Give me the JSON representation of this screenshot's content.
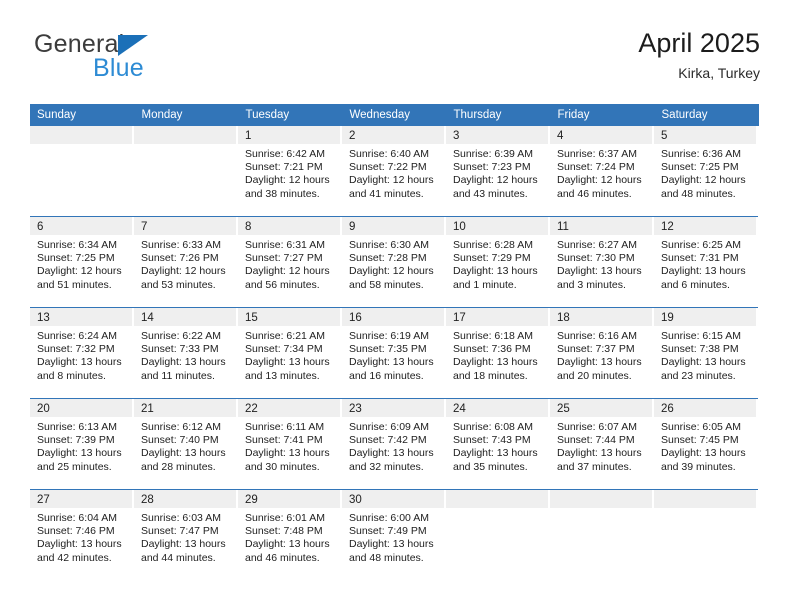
{
  "brand": {
    "name_top": "General",
    "name_bottom": "Blue",
    "accent_blue": "#2d8bd4",
    "triangle_blue": "#1b70b8",
    "header_blue": "#3275b8"
  },
  "header": {
    "title": "April 2025",
    "subtitle": "Kirka, Turkey"
  },
  "weekdays": [
    "Sunday",
    "Monday",
    "Tuesday",
    "Wednesday",
    "Thursday",
    "Friday",
    "Saturday"
  ],
  "labels": {
    "sunrise_prefix": "Sunrise:",
    "sunset_prefix": "Sunset:",
    "daylight_prefix": "Daylight:"
  },
  "weeks": [
    [
      {
        "empty": true
      },
      {
        "empty": true
      },
      {
        "day": "1",
        "sunrise": "Sunrise: 6:42 AM",
        "sunset": "Sunset: 7:21 PM",
        "daylight_1": "Daylight: 12 hours",
        "daylight_2": "and 38 minutes."
      },
      {
        "day": "2",
        "sunrise": "Sunrise: 6:40 AM",
        "sunset": "Sunset: 7:22 PM",
        "daylight_1": "Daylight: 12 hours",
        "daylight_2": "and 41 minutes."
      },
      {
        "day": "3",
        "sunrise": "Sunrise: 6:39 AM",
        "sunset": "Sunset: 7:23 PM",
        "daylight_1": "Daylight: 12 hours",
        "daylight_2": "and 43 minutes."
      },
      {
        "day": "4",
        "sunrise": "Sunrise: 6:37 AM",
        "sunset": "Sunset: 7:24 PM",
        "daylight_1": "Daylight: 12 hours",
        "daylight_2": "and 46 minutes."
      },
      {
        "day": "5",
        "sunrise": "Sunrise: 6:36 AM",
        "sunset": "Sunset: 7:25 PM",
        "daylight_1": "Daylight: 12 hours",
        "daylight_2": "and 48 minutes."
      }
    ],
    [
      {
        "day": "6",
        "sunrise": "Sunrise: 6:34 AM",
        "sunset": "Sunset: 7:25 PM",
        "daylight_1": "Daylight: 12 hours",
        "daylight_2": "and 51 minutes."
      },
      {
        "day": "7",
        "sunrise": "Sunrise: 6:33 AM",
        "sunset": "Sunset: 7:26 PM",
        "daylight_1": "Daylight: 12 hours",
        "daylight_2": "and 53 minutes."
      },
      {
        "day": "8",
        "sunrise": "Sunrise: 6:31 AM",
        "sunset": "Sunset: 7:27 PM",
        "daylight_1": "Daylight: 12 hours",
        "daylight_2": "and 56 minutes."
      },
      {
        "day": "9",
        "sunrise": "Sunrise: 6:30 AM",
        "sunset": "Sunset: 7:28 PM",
        "daylight_1": "Daylight: 12 hours",
        "daylight_2": "and 58 minutes."
      },
      {
        "day": "10",
        "sunrise": "Sunrise: 6:28 AM",
        "sunset": "Sunset: 7:29 PM",
        "daylight_1": "Daylight: 13 hours",
        "daylight_2": "and 1 minute."
      },
      {
        "day": "11",
        "sunrise": "Sunrise: 6:27 AM",
        "sunset": "Sunset: 7:30 PM",
        "daylight_1": "Daylight: 13 hours",
        "daylight_2": "and 3 minutes."
      },
      {
        "day": "12",
        "sunrise": "Sunrise: 6:25 AM",
        "sunset": "Sunset: 7:31 PM",
        "daylight_1": "Daylight: 13 hours",
        "daylight_2": "and 6 minutes."
      }
    ],
    [
      {
        "day": "13",
        "sunrise": "Sunrise: 6:24 AM",
        "sunset": "Sunset: 7:32 PM",
        "daylight_1": "Daylight: 13 hours",
        "daylight_2": "and 8 minutes."
      },
      {
        "day": "14",
        "sunrise": "Sunrise: 6:22 AM",
        "sunset": "Sunset: 7:33 PM",
        "daylight_1": "Daylight: 13 hours",
        "daylight_2": "and 11 minutes."
      },
      {
        "day": "15",
        "sunrise": "Sunrise: 6:21 AM",
        "sunset": "Sunset: 7:34 PM",
        "daylight_1": "Daylight: 13 hours",
        "daylight_2": "and 13 minutes."
      },
      {
        "day": "16",
        "sunrise": "Sunrise: 6:19 AM",
        "sunset": "Sunset: 7:35 PM",
        "daylight_1": "Daylight: 13 hours",
        "daylight_2": "and 16 minutes."
      },
      {
        "day": "17",
        "sunrise": "Sunrise: 6:18 AM",
        "sunset": "Sunset: 7:36 PM",
        "daylight_1": "Daylight: 13 hours",
        "daylight_2": "and 18 minutes."
      },
      {
        "day": "18",
        "sunrise": "Sunrise: 6:16 AM",
        "sunset": "Sunset: 7:37 PM",
        "daylight_1": "Daylight: 13 hours",
        "daylight_2": "and 20 minutes."
      },
      {
        "day": "19",
        "sunrise": "Sunrise: 6:15 AM",
        "sunset": "Sunset: 7:38 PM",
        "daylight_1": "Daylight: 13 hours",
        "daylight_2": "and 23 minutes."
      }
    ],
    [
      {
        "day": "20",
        "sunrise": "Sunrise: 6:13 AM",
        "sunset": "Sunset: 7:39 PM",
        "daylight_1": "Daylight: 13 hours",
        "daylight_2": "and 25 minutes."
      },
      {
        "day": "21",
        "sunrise": "Sunrise: 6:12 AM",
        "sunset": "Sunset: 7:40 PM",
        "daylight_1": "Daylight: 13 hours",
        "daylight_2": "and 28 minutes."
      },
      {
        "day": "22",
        "sunrise": "Sunrise: 6:11 AM",
        "sunset": "Sunset: 7:41 PM",
        "daylight_1": "Daylight: 13 hours",
        "daylight_2": "and 30 minutes."
      },
      {
        "day": "23",
        "sunrise": "Sunrise: 6:09 AM",
        "sunset": "Sunset: 7:42 PM",
        "daylight_1": "Daylight: 13 hours",
        "daylight_2": "and 32 minutes."
      },
      {
        "day": "24",
        "sunrise": "Sunrise: 6:08 AM",
        "sunset": "Sunset: 7:43 PM",
        "daylight_1": "Daylight: 13 hours",
        "daylight_2": "and 35 minutes."
      },
      {
        "day": "25",
        "sunrise": "Sunrise: 6:07 AM",
        "sunset": "Sunset: 7:44 PM",
        "daylight_1": "Daylight: 13 hours",
        "daylight_2": "and 37 minutes."
      },
      {
        "day": "26",
        "sunrise": "Sunrise: 6:05 AM",
        "sunset": "Sunset: 7:45 PM",
        "daylight_1": "Daylight: 13 hours",
        "daylight_2": "and 39 minutes."
      }
    ],
    [
      {
        "day": "27",
        "sunrise": "Sunrise: 6:04 AM",
        "sunset": "Sunset: 7:46 PM",
        "daylight_1": "Daylight: 13 hours",
        "daylight_2": "and 42 minutes."
      },
      {
        "day": "28",
        "sunrise": "Sunrise: 6:03 AM",
        "sunset": "Sunset: 7:47 PM",
        "daylight_1": "Daylight: 13 hours",
        "daylight_2": "and 44 minutes."
      },
      {
        "day": "29",
        "sunrise": "Sunrise: 6:01 AM",
        "sunset": "Sunset: 7:48 PM",
        "daylight_1": "Daylight: 13 hours",
        "daylight_2": "and 46 minutes."
      },
      {
        "day": "30",
        "sunrise": "Sunrise: 6:00 AM",
        "sunset": "Sunset: 7:49 PM",
        "daylight_1": "Daylight: 13 hours",
        "daylight_2": "and 48 minutes."
      },
      {
        "empty": true
      },
      {
        "empty": true
      },
      {
        "empty": true
      }
    ]
  ]
}
